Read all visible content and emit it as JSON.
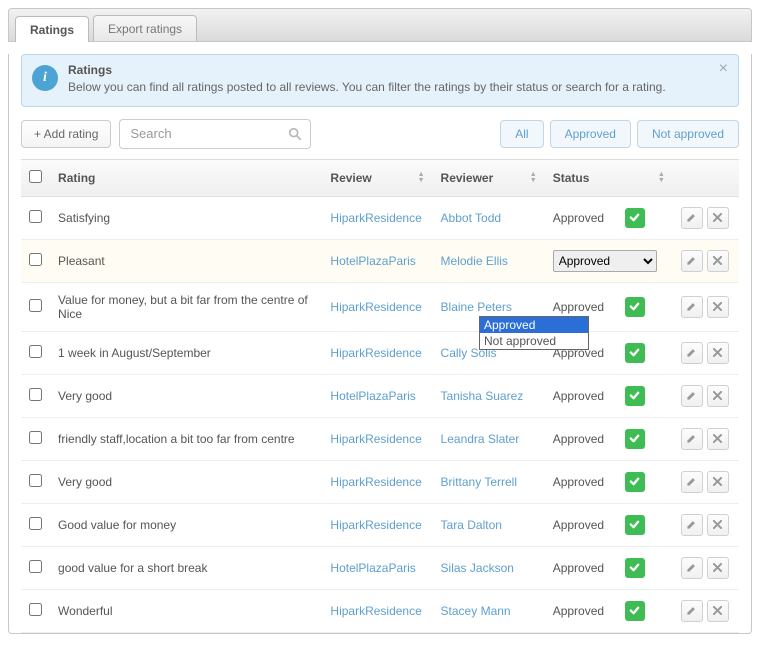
{
  "tabs": {
    "ratings": "Ratings",
    "export": "Export ratings"
  },
  "info": {
    "title": "Ratings",
    "text": "Below you can find all ratings posted to all reviews. You can filter the ratings by their status or search for a rating."
  },
  "toolbar": {
    "add_label": "+ Add rating",
    "search_placeholder": "Search",
    "filter_all": "All",
    "filter_approved": "Approved",
    "filter_not_approved": "Not approved"
  },
  "columns": {
    "rating": "Rating",
    "review": "Review",
    "reviewer": "Reviewer",
    "status": "Status"
  },
  "status_value": "Approved",
  "dropdown_options": {
    "approved": "Approved",
    "not_approved": "Not approved"
  },
  "rows": [
    {
      "rating": "Satisfying",
      "review": "HiparkResidence",
      "reviewer": "Abbot Todd"
    },
    {
      "rating": "Pleasant",
      "review": "HotelPlazaParis",
      "reviewer": "Melodie Ellis"
    },
    {
      "rating": "Value for money, but a bit far from the centre of Nice",
      "review": "HiparkResidence",
      "reviewer": "Blaine Peters"
    },
    {
      "rating": "1 week in August/September",
      "review": "HiparkResidence",
      "reviewer": "Cally Solis"
    },
    {
      "rating": "Very good",
      "review": "HotelPlazaParis",
      "reviewer": "Tanisha Suarez"
    },
    {
      "rating": "friendly staff,location a bit too far from centre",
      "review": "HiparkResidence",
      "reviewer": "Leandra Slater"
    },
    {
      "rating": "Very good",
      "review": "HiparkResidence",
      "reviewer": "Brittany Terrell"
    },
    {
      "rating": "Good value for money",
      "review": "HiparkResidence",
      "reviewer": "Tara Dalton"
    },
    {
      "rating": "good value for a short break",
      "review": "HotelPlazaParis",
      "reviewer": "Silas Jackson"
    },
    {
      "rating": "Wonderful",
      "review": "HiparkResidence",
      "reviewer": "Stacey Mann"
    }
  ]
}
